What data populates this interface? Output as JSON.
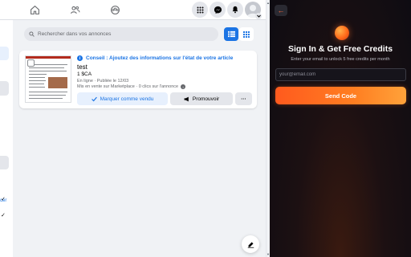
{
  "facebook": {
    "leftpane": {
      "partial_link": "cer",
      "check_mark": "✓"
    },
    "search": {
      "placeholder": "Rechercher dans vos annonces"
    },
    "listing": {
      "tip": "Conseil : Ajoutez des informations sur l'état de votre article",
      "tip_icon": "i",
      "title": "test",
      "price": "1 $CA",
      "status": "En ligne · Publiée le 12/03",
      "meta": "Mis en vente sur Marketplace · 0 clics sur l'annonce",
      "meta_icon": "i",
      "mark_sold_label": "Marquer comme vendu",
      "promote_label": "Promouvoir",
      "more_label": "···"
    },
    "scroll": {
      "up": "▲",
      "down": "▼"
    }
  },
  "extension": {
    "back_icon": "←",
    "title": "Sign In & Get Free Credits",
    "subtitle": "Enter your email to unlock 5 free credits per month",
    "email_placeholder": "your@email.com",
    "send_label": "Send Code",
    "accent_color": "#ff6a1a",
    "background_color": "#0e0c12"
  },
  "colors": {
    "facebook_blue": "#1b74e4",
    "page_bg": "#f0f2f5"
  }
}
